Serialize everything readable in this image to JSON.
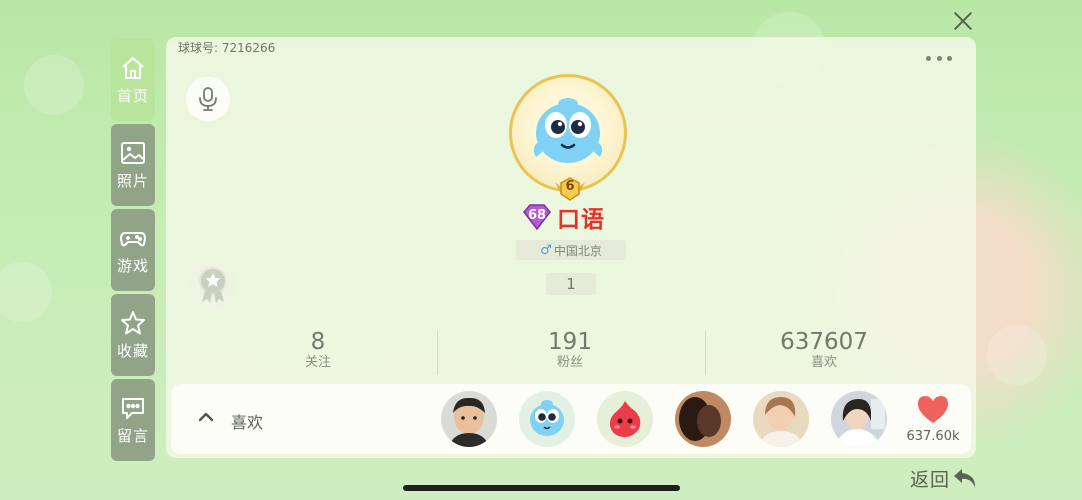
{
  "window": {
    "close_icon": "close-icon"
  },
  "sidebar": {
    "items": [
      {
        "label": "首页",
        "icon": "home-icon",
        "active": true
      },
      {
        "label": "照片",
        "icon": "image-icon",
        "active": false
      },
      {
        "label": "游戏",
        "icon": "gamepad-icon",
        "active": false
      },
      {
        "label": "收藏",
        "icon": "star-icon",
        "active": false
      },
      {
        "label": "留言",
        "icon": "message-icon",
        "active": false
      }
    ]
  },
  "profile": {
    "uid_text": "球球号: 7216266",
    "level": "6",
    "gem_level": "68",
    "nickname": "口语",
    "gender_symbol": "♂",
    "location": "中国北京",
    "count": "1"
  },
  "stats": {
    "following": {
      "value": "8",
      "label": "关注"
    },
    "followers": {
      "value": "191",
      "label": "粉丝"
    },
    "likes": {
      "value": "637607",
      "label": "喜欢"
    }
  },
  "likes_bar": {
    "label": "喜欢",
    "total": "637.60k",
    "avatars": [
      "kid-photo-avatar",
      "blue-blob-avatar",
      "red-blob-avatar",
      "dark-photo-avatar",
      "girl-photo-avatar",
      "woman-photo-avatar"
    ]
  },
  "footer": {
    "back_label": "返回"
  },
  "colors": {
    "accent_green": "#b8e59b",
    "name_red": "#e6322c",
    "heart_red": "#f0625e"
  }
}
